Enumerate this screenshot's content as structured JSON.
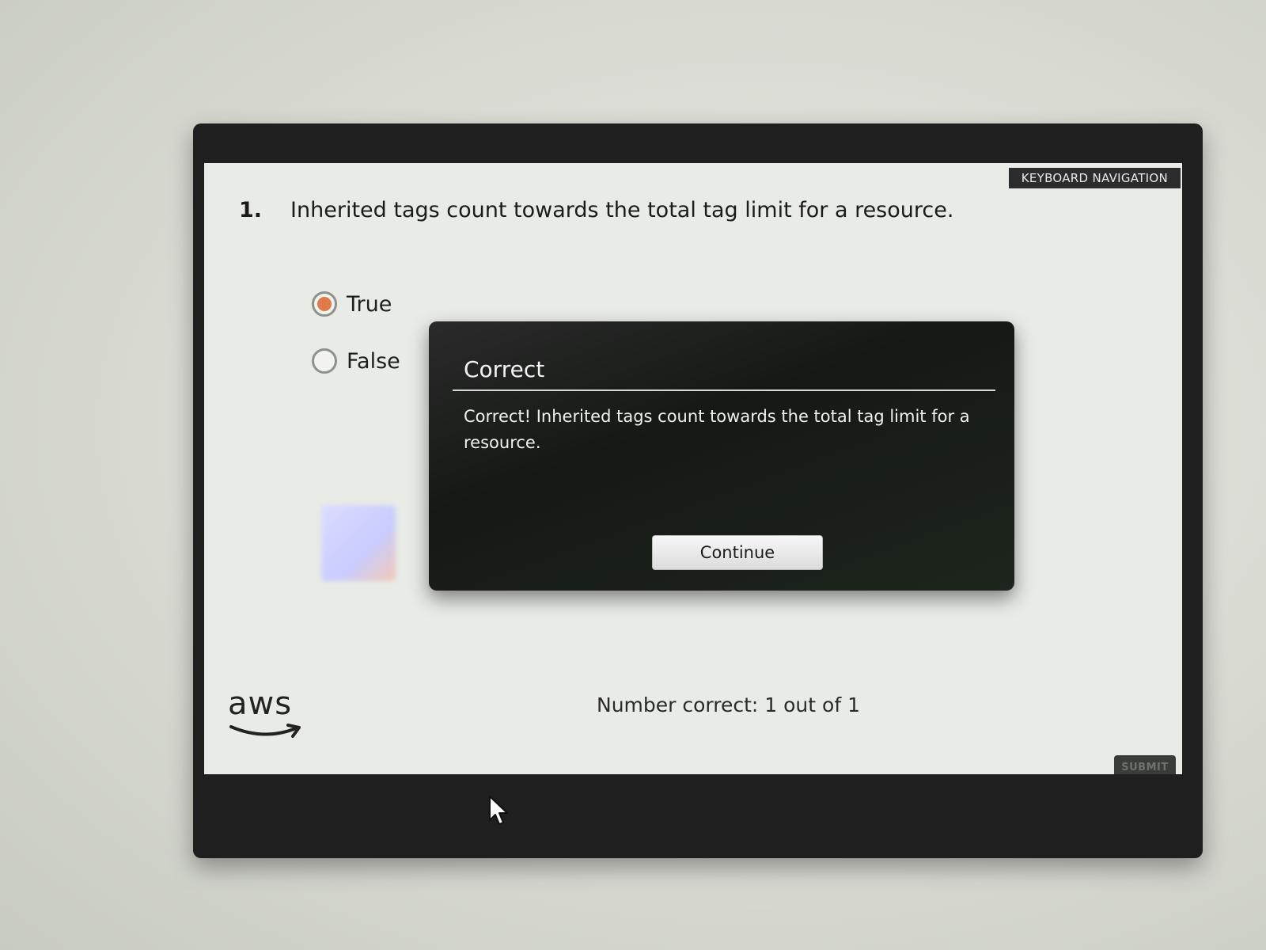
{
  "header": {
    "keyboard_navigation_label": "KEYBOARD NAVIGATION"
  },
  "question": {
    "number": "1.",
    "text": "Inherited tags count towards the total tag limit for a resource.",
    "options": [
      {
        "label": "True",
        "selected": true
      },
      {
        "label": "False",
        "selected": false
      }
    ]
  },
  "feedback": {
    "title": "Correct",
    "message": "Correct! Inherited tags count towards the total tag limit for a resource.",
    "continue_label": "Continue"
  },
  "footer": {
    "logo_text": "aws",
    "score_text": "Number correct: 1 out of 1",
    "submit_label": "SUBMIT"
  },
  "colors": {
    "selected_radio": "#e07a4a",
    "frame": "#1e1f1e",
    "modal_bg": "#151915"
  },
  "icons": {
    "cursor": "mouse-pointer-icon",
    "logo_smile": "aws-smile-arrow-icon"
  }
}
